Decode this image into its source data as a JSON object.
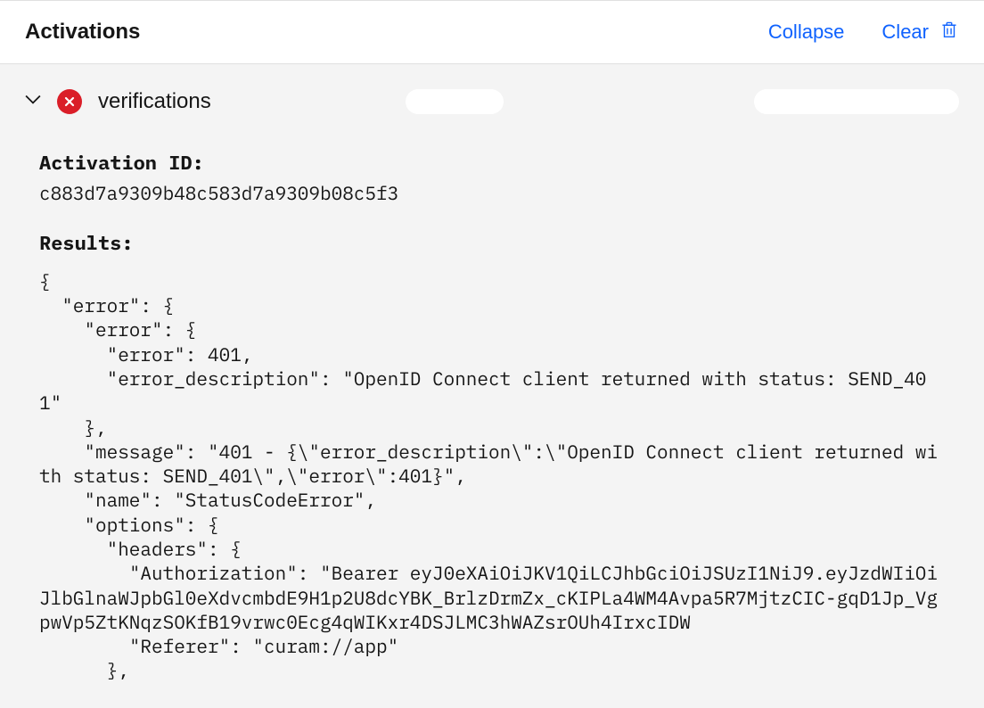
{
  "header": {
    "title": "Activations",
    "collapse_label": "Collapse",
    "clear_label": "Clear"
  },
  "activation": {
    "name": "verifications",
    "status": "error",
    "id_label": "Activation ID:",
    "id_value": "c883d7a9309b48c583d7a9309b08c5f3",
    "results_label": "Results:",
    "results_body": "{\n  \"error\": {\n    \"error\": {\n      \"error\": 401,\n      \"error_description\": \"OpenID Connect client returned with status: SEND_401\"\n    },\n    \"message\": \"401 - {\\\"error_description\\\":\\\"OpenID Connect client returned with status: SEND_401\\\",\\\"error\\\":401}\",\n    \"name\": \"StatusCodeError\",\n    \"options\": {\n      \"headers\": {\n        \"Authorization\": \"Bearer eyJ0eXAiOiJKV1QiLCJhbGciOiJSUzI1NiJ9.eyJzdWIiOiJlbGlnaWJpbGl0eXdvcmbdE9H1p2U8dcYBK_BrlzDrmZx_cKIPLa4WM4Avpa5R7MjtzCIC-gqD1Jp_VgpwVp5ZtKNqzSOKfB19vrwc0Ecg4qWIKxr4DSJLMC3hWAZsrOUh4IrxcIDW\n        \"Referer\": \"curam://app\"\n      },"
  }
}
